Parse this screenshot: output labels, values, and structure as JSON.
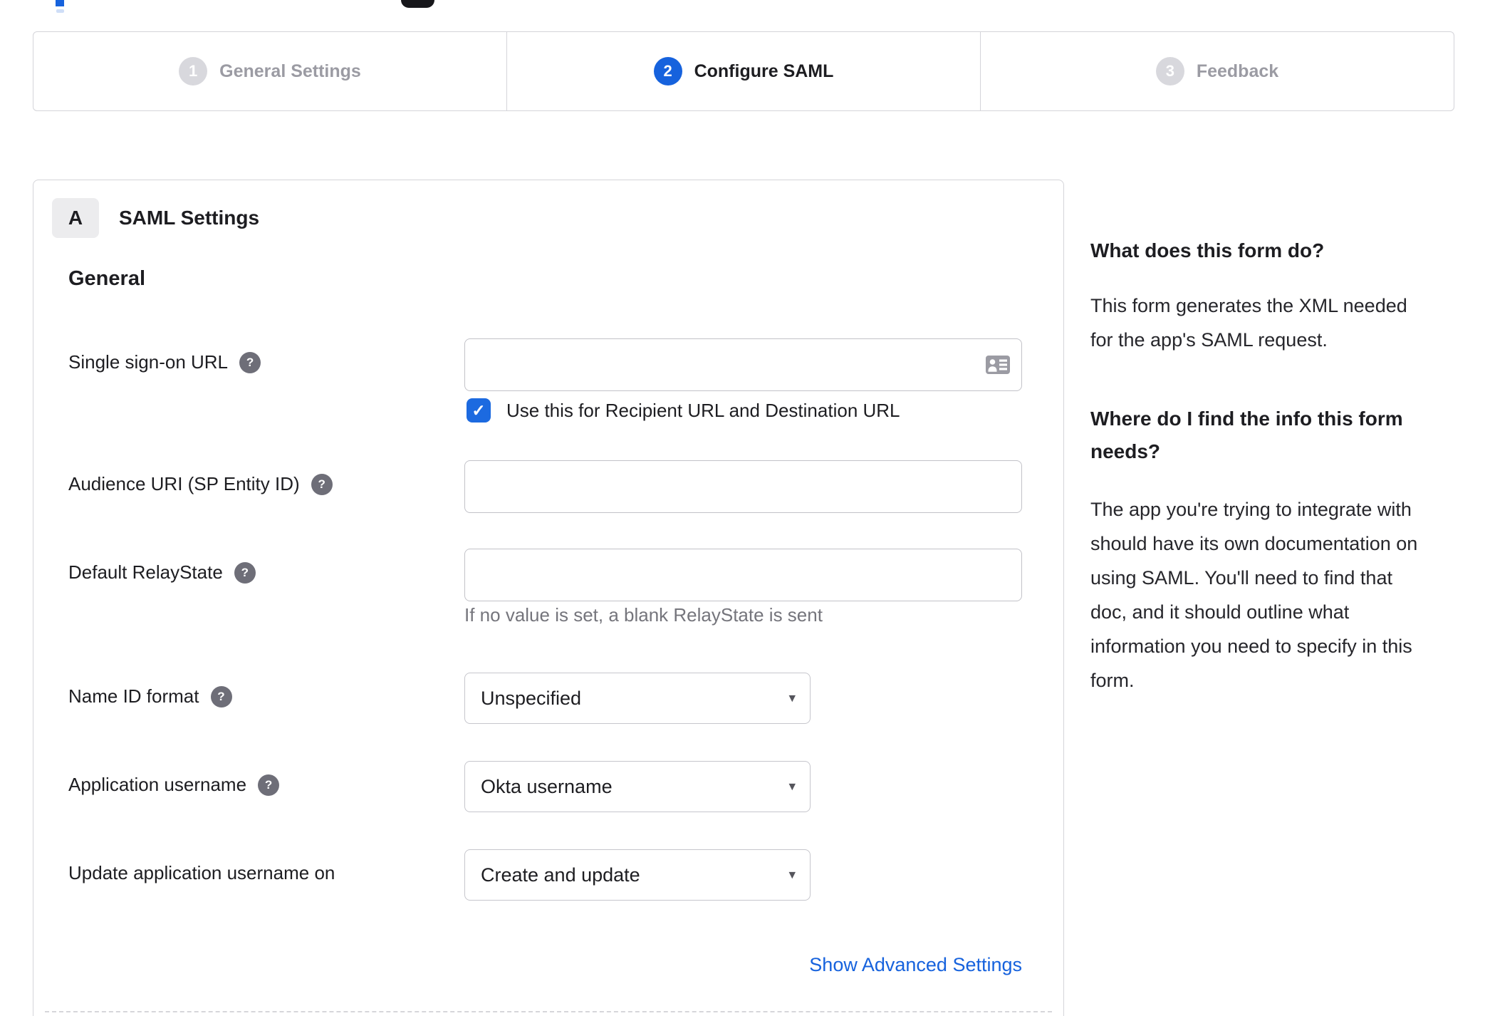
{
  "colors": {
    "accent_blue": "#1662dd",
    "checkbox_blue": "#1c6ae0",
    "border_gray": "#d4d4d9",
    "input_border": "#c2c2c8",
    "text_dark": "#1d1d21",
    "text_gray": "#9b9ba3",
    "helper_gray": "#75757c",
    "help_icon_bg": "#6e6e78",
    "inactive_circle": "#d8d8dd"
  },
  "icons": {
    "question": "?",
    "check": "✓",
    "caret": "▾",
    "contact_card": "contact-card-icon"
  },
  "wizard": {
    "steps": [
      {
        "number": "1",
        "label": "General Settings",
        "state": "inactive"
      },
      {
        "number": "2",
        "label": "Configure SAML",
        "state": "active"
      },
      {
        "number": "3",
        "label": "Feedback",
        "state": "inactive"
      }
    ]
  },
  "panel": {
    "section_badge": "A",
    "section_title": "SAML Settings",
    "group_heading": "General",
    "fields": [
      {
        "label": "Single sign-on URL",
        "has_help": true,
        "type": "text",
        "value": "",
        "checkbox": {
          "checked": true,
          "label": "Use this for Recipient URL and Destination URL"
        }
      },
      {
        "label": "Audience URI (SP Entity ID)",
        "has_help": true,
        "type": "text",
        "value": ""
      },
      {
        "label": "Default RelayState",
        "has_help": true,
        "type": "text",
        "value": "",
        "helper": "If no value is set, a blank RelayState is sent"
      },
      {
        "label": "Name ID format",
        "has_help": true,
        "type": "select",
        "value": "Unspecified"
      },
      {
        "label": "Application username",
        "has_help": true,
        "type": "select",
        "value": "Okta username"
      },
      {
        "label": "Update application username on",
        "has_help": false,
        "type": "select",
        "value": "Create and update"
      }
    ],
    "advanced_link": "Show Advanced Settings"
  },
  "help_panel": {
    "sections": [
      {
        "heading_lines": [
          "What does this form do?"
        ],
        "body_lines": [
          "This form generates the XML needed",
          "for the app's SAML request."
        ]
      },
      {
        "heading_lines": [
          "Where do I find the info this form",
          "needs?"
        ],
        "body_lines": [
          "The app you're trying to integrate with",
          "should have its own documentation on",
          "using SAML. You'll need to find that",
          "doc, and it should outline what",
          "information you need to specify in this",
          "form."
        ]
      }
    ]
  }
}
